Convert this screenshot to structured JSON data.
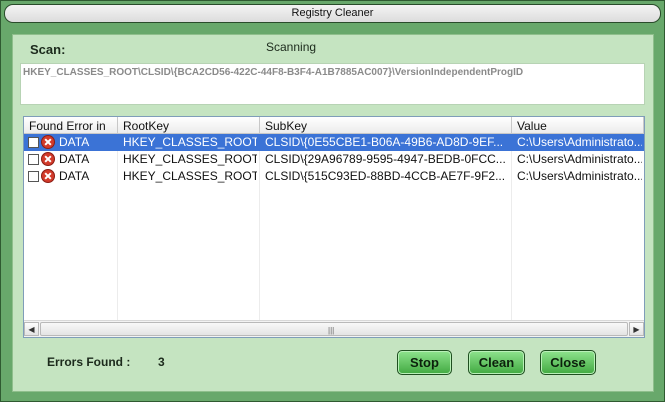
{
  "window": {
    "title": "Registry Cleaner"
  },
  "scan": {
    "label": "Scan:",
    "status": "Scanning",
    "current_path": "HKEY_CLASSES_ROOT\\CLSID\\{BCA2CD56-422C-44F8-B3F4-A1B7885AC007}\\VersionIndependentProgID"
  },
  "table": {
    "columns": [
      "Found Error in",
      "RootKey",
      "SubKey",
      "Value"
    ],
    "rows": [
      {
        "found": "DATA",
        "rootkey": "HKEY_CLASSES_ROOT",
        "subkey": "CLSID\\{0E55CBE1-B06A-49B6-AD8D-9EF...",
        "value": "C:\\Users\\Administrato..."
      },
      {
        "found": "DATA",
        "rootkey": "HKEY_CLASSES_ROOT",
        "subkey": "CLSID\\{29A96789-9595-4947-BEDB-0FCC...",
        "value": "C:\\Users\\Administrato..."
      },
      {
        "found": "DATA",
        "rootkey": "HKEY_CLASSES_ROOT",
        "subkey": "CLSID\\{515C93ED-88BD-4CCB-AE7F-9F2...",
        "value": "C:\\Users\\Administrato..."
      }
    ],
    "selected_row": 0
  },
  "footer": {
    "errors_label": "Errors Found :",
    "errors_count": "3",
    "stop_label": "Stop",
    "clean_label": "Clean",
    "close_label": "Close"
  },
  "colors": {
    "window_bg": "#68a86b",
    "panel_bg": "#c5e4c1",
    "button_green": "#41a941",
    "selection": "#3b73d6",
    "error_icon": "#d23a2a"
  }
}
